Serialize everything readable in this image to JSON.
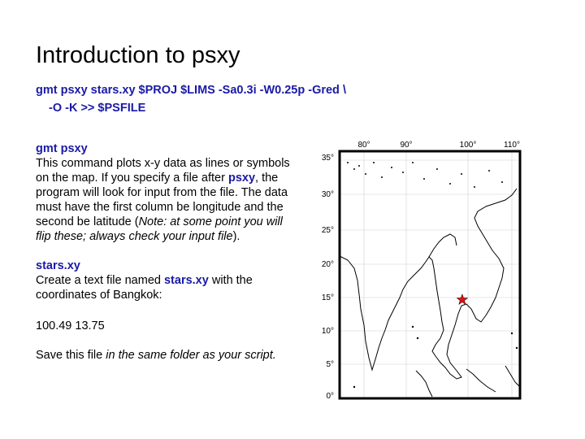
{
  "slide": {
    "title": "Introduction to psxy",
    "command_line1": "gmt psxy stars.xy $PROJ $LIMS -Sa0.3i -W0.25p -Gred \\",
    "command_line2": "-O -K >> $PSFILE"
  },
  "body": {
    "psxy_heading": "gmt psxy",
    "psxy_text_1": "This command plots x-y data as lines or symbols on the map. If you specify a file after ",
    "psxy_inline": "psxy",
    "psxy_text_2": ", the program will look for input from the file. The data must have the first column be longitude and the second be latitude (",
    "psxy_note": "Note: at some point you will flip these; always check your input file",
    "psxy_text_3": ").",
    "stars_heading": "stars.xy",
    "stars_text_1": "Create a text file named ",
    "stars_inline": "stars.xy",
    "stars_text_2": " with the coordinates of Bangkok:",
    "coords": "100.49 13.75",
    "save_text_1": "Save this file ",
    "save_text_2": "in the same folder as your script."
  },
  "map": {
    "lon_labels": [
      "80°",
      "90°",
      "100°",
      "110°"
    ],
    "lat_labels": [
      "35°",
      "30°",
      "25°",
      "20°",
      "15°",
      "10°",
      "5°",
      "0°"
    ],
    "marker": {
      "name": "Bangkok",
      "lon": 100.49,
      "lat": 13.75,
      "symbol": "star",
      "color": "#dd1111"
    },
    "frame_color": "#000000",
    "grid_color": "#d0d0d0"
  }
}
